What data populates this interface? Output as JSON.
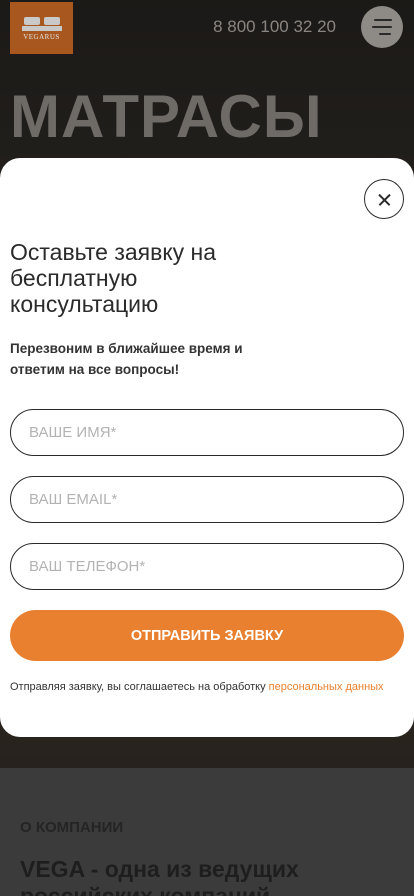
{
  "header": {
    "logo_text": "VEGARUS",
    "phone": "8 800 100 32 20",
    "menu_icon": "hamburger-icon"
  },
  "hero": {
    "title": "МАТРАСЫ"
  },
  "about": {
    "label": "О КОМПАНИИ",
    "title": "VEGA - одна из ведущих российских компаний"
  },
  "modal": {
    "close_icon": "close-icon",
    "title": "Оставьте заявку на бесплатную консультацию",
    "subtitle": "Перезвоним в ближайшее время и ответим на все вопросы!",
    "fields": {
      "name": {
        "placeholder": "ВАШЕ ИМЯ*",
        "value": ""
      },
      "email": {
        "placeholder": "ВАШ EMAIL*",
        "value": ""
      },
      "phone": {
        "placeholder": "ВАШ ТЕЛЕФОН*",
        "value": ""
      }
    },
    "submit_label": "ОТПРАВИТЬ ЗАЯВКУ",
    "consent_text": "Отправляя заявку, вы соглашаетесь на обработку ",
    "consent_link": "персональных данных"
  },
  "colors": {
    "accent": "#e9802f",
    "logo_bg": "#a8581f"
  }
}
